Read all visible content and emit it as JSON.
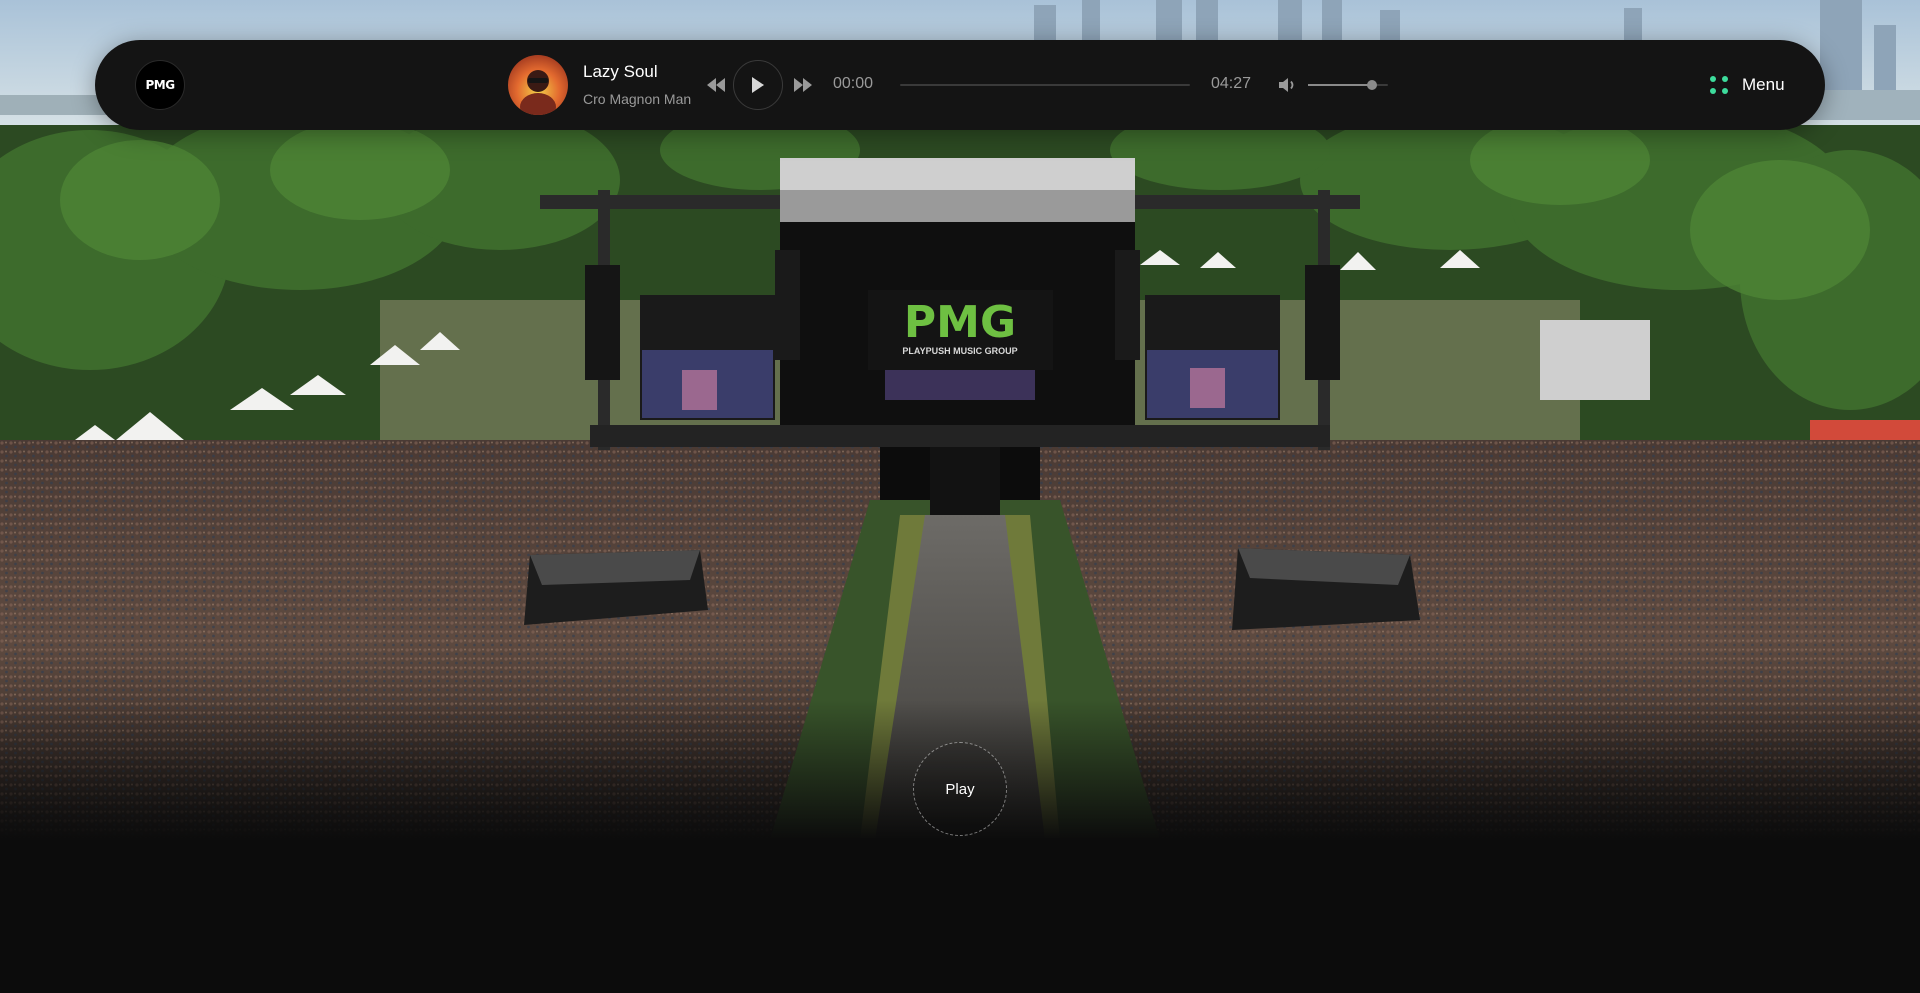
{
  "header": {
    "logo_text": "PMG",
    "menu_label": "Menu"
  },
  "player": {
    "track_title": "Lazy Soul",
    "track_artist": "Cro Magnon Man",
    "time_current": "00:00",
    "time_total": "04:27",
    "progress_fraction": 0.0,
    "volume_fraction": 0.8
  },
  "hero": {
    "play_label": "Play",
    "screen_logo": "PMG",
    "screen_subtitle": "PLAYPUSH MUSIC GROUP"
  },
  "icons": {
    "rewind": "rewind-icon",
    "play": "play-icon",
    "forward": "fast-forward-icon",
    "volume": "volume-icon",
    "menu": "menu-dots-icon"
  },
  "colors": {
    "accent": "#3ddc9c",
    "bar_background": "#141414",
    "page_background": "#0c0c0c"
  }
}
